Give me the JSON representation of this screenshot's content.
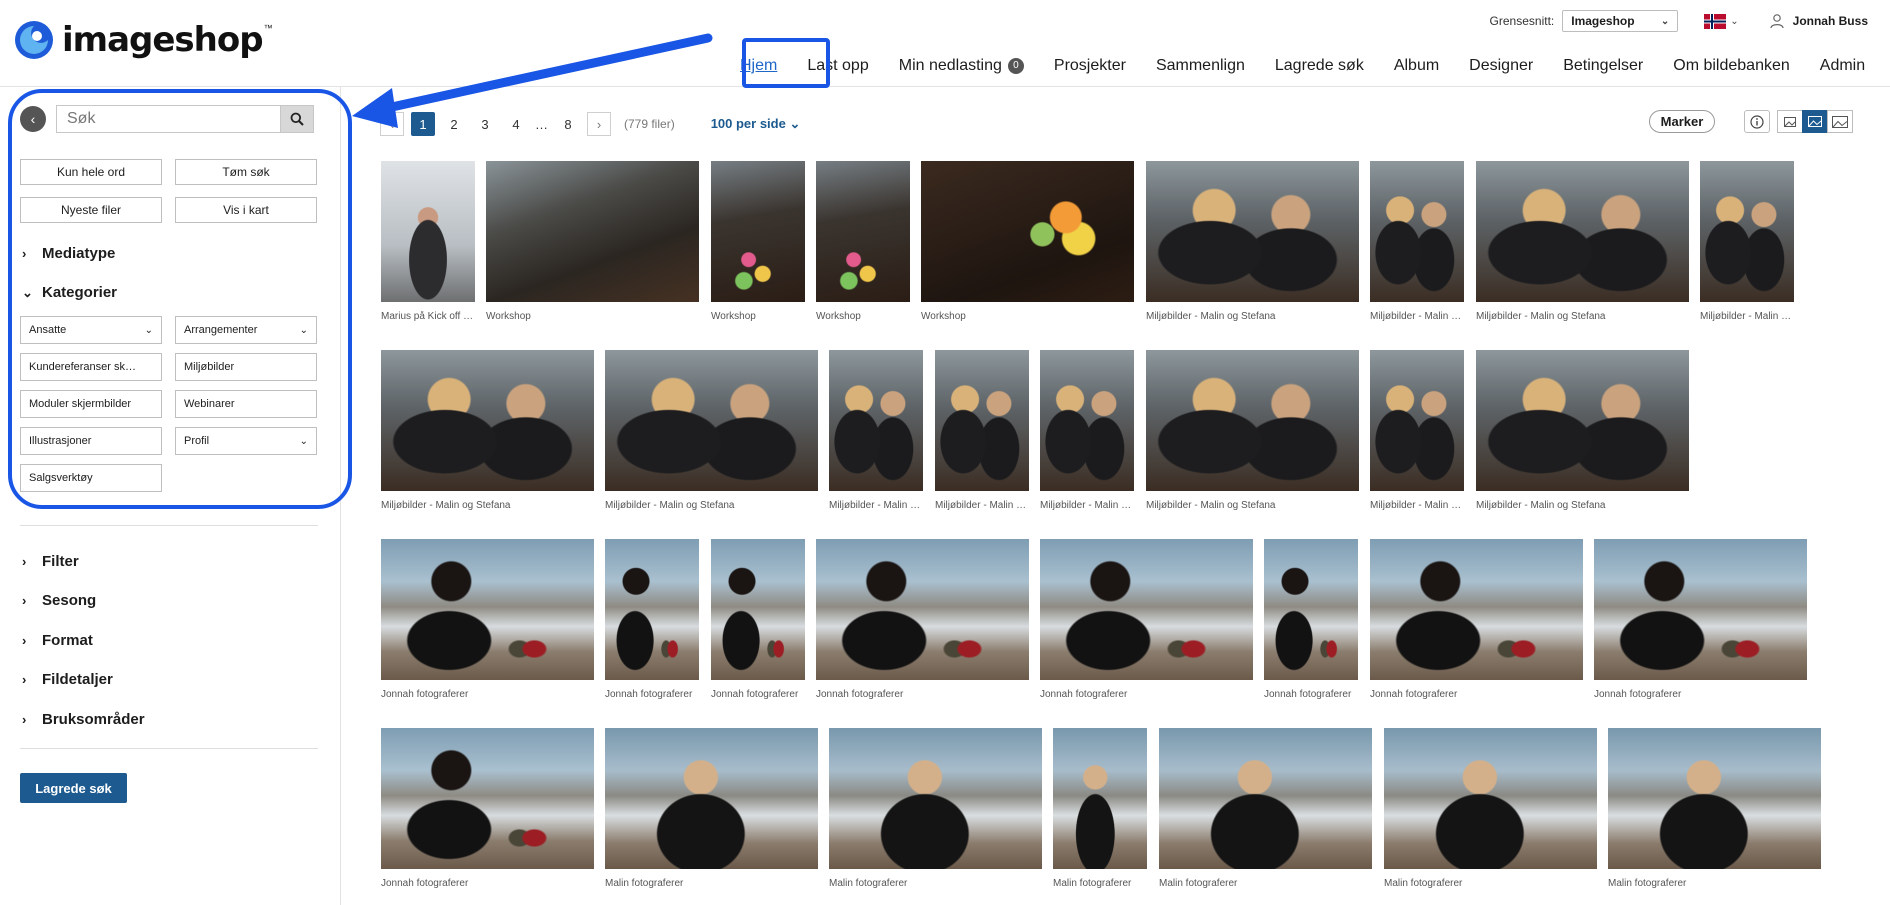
{
  "header": {
    "logo_text": "imageshop",
    "logo_tm": "™",
    "interface_label": "Grensesnitt:",
    "interface_value": "Imageshop",
    "language_flag": "norway-flag-icon",
    "user_name": "Jonnah Buss"
  },
  "nav": {
    "items": [
      {
        "label": "Hjem"
      },
      {
        "label": "Last opp"
      },
      {
        "label": "Min nedlasting",
        "badge": "0"
      },
      {
        "label": "Prosjekter"
      },
      {
        "label": "Sammenlign"
      },
      {
        "label": "Lagrede søk"
      },
      {
        "label": "Album"
      },
      {
        "label": "Designer"
      },
      {
        "label": "Betingelser"
      },
      {
        "label": "Om bildebanken"
      },
      {
        "label": "Admin"
      }
    ],
    "active_index": 0
  },
  "sidebar": {
    "search_placeholder": "Søk",
    "buttons": [
      "Kun hele ord",
      "Tøm søk",
      "Nyeste filer",
      "Vis i kart"
    ],
    "sections": {
      "mediatype": "Mediatype",
      "kategorier": "Kategorier",
      "filter": "Filter",
      "sesong": "Sesong",
      "format": "Format",
      "fildetaljer": "Fildetaljer",
      "bruksomrader": "Bruksområder"
    },
    "categories": [
      {
        "label": "Ansatte",
        "dropdown": true
      },
      {
        "label": "Arrangementer",
        "dropdown": true
      },
      {
        "label": "Kundereferanser sk…",
        "dropdown": false
      },
      {
        "label": "Miljøbilder",
        "dropdown": false
      },
      {
        "label": "Moduler skjermbilder",
        "dropdown": false
      },
      {
        "label": "Webinarer",
        "dropdown": false
      },
      {
        "label": "Illustrasjoner",
        "dropdown": false
      },
      {
        "label": "Profil",
        "dropdown": true
      },
      {
        "label": "Salgsverktøy",
        "dropdown": false
      }
    ],
    "saved_search_button": "Lagrede søk"
  },
  "results": {
    "pages": [
      "1",
      "2",
      "3",
      "4",
      "…",
      "8"
    ],
    "current_page": "1",
    "total": "(779 filer)",
    "per_page": "100 per side",
    "marker_button": "Marker"
  },
  "thumbnails": [
    {
      "caption": "Marius på Kick off …",
      "kind": "man"
    },
    {
      "caption": "Workshop",
      "kind": "office"
    },
    {
      "caption": "Workshop",
      "kind": "desk"
    },
    {
      "caption": "Workshop",
      "kind": "desk"
    },
    {
      "caption": "Workshop",
      "kind": "sticky"
    },
    {
      "caption": "Miljøbilder - Malin og Stefana",
      "kind": "women"
    },
    {
      "caption": "Miljøbilder - Malin …",
      "kind": "women"
    },
    {
      "caption": "Miljøbilder - Malin og Stefana",
      "kind": "women"
    },
    {
      "caption": "Miljøbilder - Malin …",
      "kind": "women"
    },
    {
      "caption": "Miljøbilder - Malin og Stefana",
      "kind": "women"
    },
    {
      "caption": "Miljøbilder - Malin og Stefana",
      "kind": "women"
    },
    {
      "caption": "Miljøbilder - Malin …",
      "kind": "women"
    },
    {
      "caption": "Miljøbilder - Malin …",
      "kind": "women"
    },
    {
      "caption": "Miljøbilder - Malin …",
      "kind": "women"
    },
    {
      "caption": "Miljøbilder - Malin og Stefana",
      "kind": "women"
    },
    {
      "caption": "Miljøbilder - Malin …",
      "kind": "women"
    },
    {
      "caption": "Miljøbilder - Malin og Stefana",
      "kind": "women"
    },
    {
      "caption": "Jonnah fotograferer",
      "kind": "mountain"
    },
    {
      "caption": "Jonnah fotograferer",
      "kind": "mountain"
    },
    {
      "caption": "Jonnah fotograferer",
      "kind": "mountain"
    },
    {
      "caption": "Jonnah fotograferer",
      "kind": "mountain"
    },
    {
      "caption": "Jonnah fotograferer",
      "kind": "mountain"
    },
    {
      "caption": "Jonnah fotograferer",
      "kind": "mountain"
    },
    {
      "caption": "Jonnah fotograferer",
      "kind": "mountain"
    },
    {
      "caption": "Jonnah fotograferer",
      "kind": "mountain"
    },
    {
      "caption": "Jonnah fotograferer",
      "kind": "mountain"
    },
    {
      "caption": "Malin fotograferer",
      "kind": "camera"
    },
    {
      "caption": "Malin fotograferer",
      "kind": "camera"
    },
    {
      "caption": "Malin fotograferer",
      "kind": "camera"
    },
    {
      "caption": "Malin fotograferer",
      "kind": "camera"
    },
    {
      "caption": "Malin fotograferer",
      "kind": "camera"
    },
    {
      "caption": "Malin fotograferer",
      "kind": "camera"
    }
  ],
  "colors": {
    "accent": "#1c5a8f",
    "annotation": "#1a56e6",
    "active_link": "#1f66c9"
  }
}
